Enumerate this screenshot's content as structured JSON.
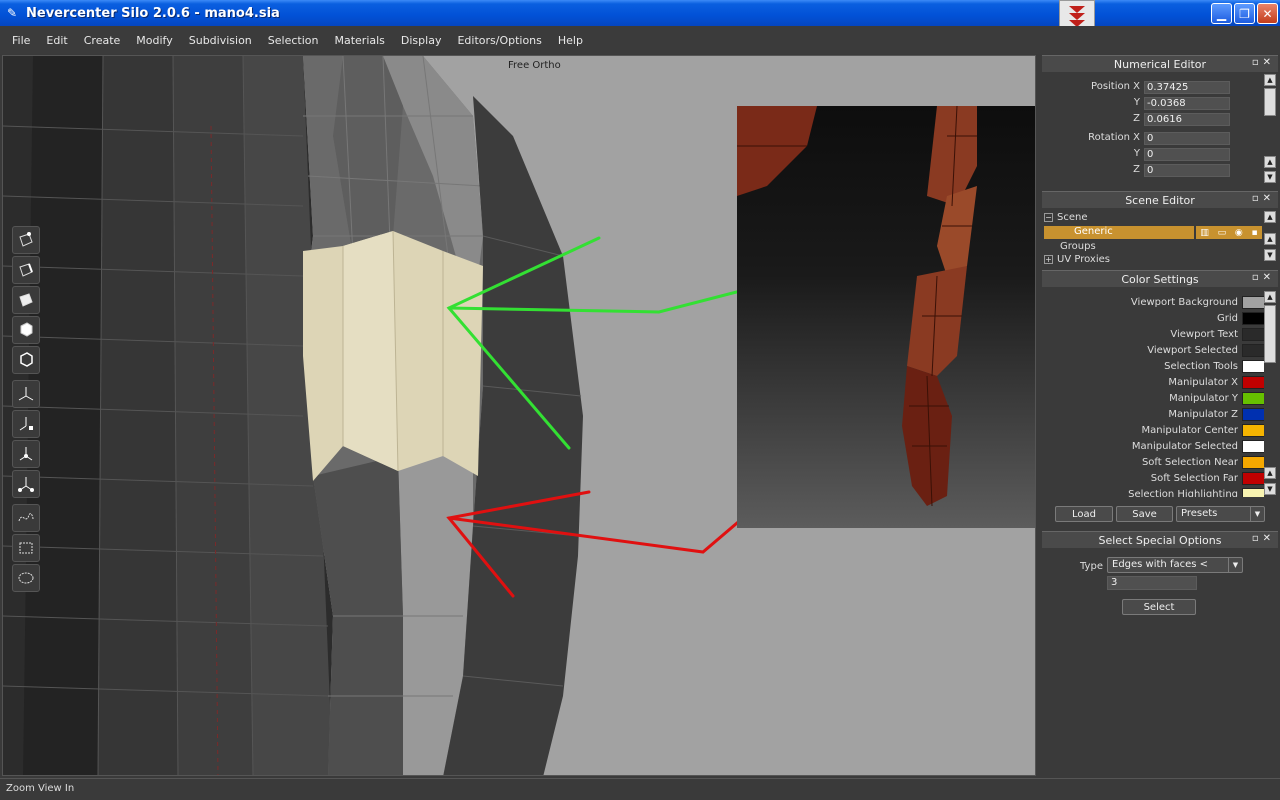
{
  "window": {
    "title": "Nevercenter Silo 2.0.6 - mano4.sia"
  },
  "menu": [
    "File",
    "Edit",
    "Create",
    "Modify",
    "Subdivision",
    "Selection",
    "Materials",
    "Display",
    "Editors/Options",
    "Help"
  ],
  "viewport": {
    "label": "Free Ortho"
  },
  "status": {
    "text": "Zoom View In"
  },
  "numerical_editor": {
    "title": "Numerical Editor",
    "position": {
      "label_x": "Position X",
      "x": "0.37425",
      "y": "-0.0368",
      "z": "0.0616"
    },
    "rotation": {
      "label_x": "Rotation X",
      "x": "0",
      "y": "0",
      "z": "0"
    },
    "axis_y": "Y",
    "axis_z": "Z"
  },
  "scene_editor": {
    "title": "Scene Editor",
    "items": [
      "Scene",
      "Generic",
      "Groups",
      "UV Proxies"
    ]
  },
  "color_settings": {
    "title": "Color Settings",
    "items": [
      {
        "label": "Viewport Background",
        "color": "#a2a2a2"
      },
      {
        "label": "Grid",
        "color": "#000000"
      },
      {
        "label": "Viewport Text",
        "color": "#2a2a2a"
      },
      {
        "label": "Viewport Selected",
        "color": "#2a2a2a"
      },
      {
        "label": "Selection Tools",
        "color": "#ffffff"
      },
      {
        "label": "Manipulator X",
        "color": "#c00000"
      },
      {
        "label": "Manipulator Y",
        "color": "#66c000"
      },
      {
        "label": "Manipulator Z",
        "color": "#0030b0"
      },
      {
        "label": "Manipulator Center",
        "color": "#f5b400"
      },
      {
        "label": "Manipulator Selected",
        "color": "#ffffff"
      },
      {
        "label": "Soft Selection Near",
        "color": "#f5a800"
      },
      {
        "label": "Soft Selection Far",
        "color": "#c00000"
      },
      {
        "label": "Selection Highlighting",
        "color": "#f7f2b0"
      }
    ],
    "load_label": "Load",
    "save_label": "Save",
    "presets_label": "Presets"
  },
  "select_special": {
    "title": "Select Special Options",
    "type_label": "Type",
    "type_value": "Edges with faces <",
    "count_value": "3",
    "select_label": "Select"
  }
}
